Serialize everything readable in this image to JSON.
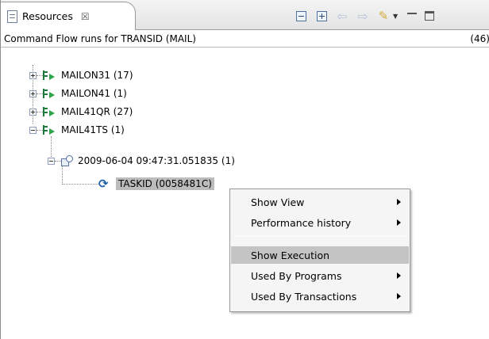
{
  "tab": {
    "icon": "resources-view-icon",
    "label": "Resources",
    "close": "☒"
  },
  "toolbar": {
    "icons": [
      "collapse-all-icon",
      "expand-all-icon",
      "back-icon",
      "forward-icon",
      "filter-icon",
      "view-menu-icon",
      "minimize-icon",
      "maximize-icon"
    ]
  },
  "header": {
    "title": "Command Flow runs for TRANSID (MAIL)",
    "count": "(46)"
  },
  "tree": {
    "nodes": [
      {
        "label": "MAILON31  (17)",
        "expanded": false
      },
      {
        "label": "MAILON41  (1)",
        "expanded": false
      },
      {
        "label": "MAIL41QR  (27)",
        "expanded": false
      },
      {
        "label": "MAIL41TS  (1)",
        "expanded": true
      },
      {
        "label": "2009-06-04 09:47:31.051835  (1)",
        "expanded": true
      },
      {
        "label": "TASKID (0058481C)",
        "selected": true
      }
    ]
  },
  "context_menu": {
    "items": [
      {
        "label": "Show View",
        "submenu": true
      },
      {
        "label": "Performance history",
        "submenu": true
      },
      {
        "label": "Show Execution",
        "submenu": false,
        "highlighted": true
      },
      {
        "label": "Used By Programs",
        "submenu": true
      },
      {
        "label": "Used By Transactions",
        "submenu": true
      }
    ]
  },
  "colors": {
    "selection": "#bcbcbc",
    "menu_highlight": "#c4c4c4",
    "flow_icon_green": "#2da34a"
  }
}
